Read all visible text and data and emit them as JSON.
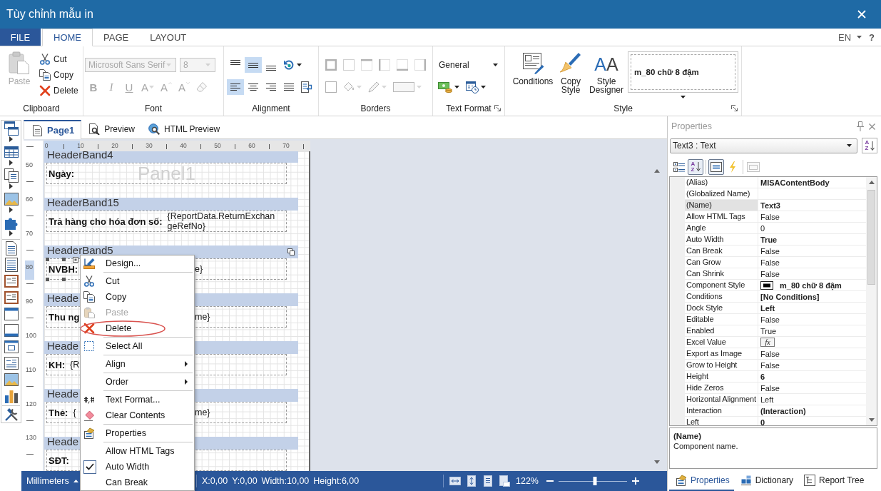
{
  "window": {
    "title": "Tùy chỉnh mẫu in"
  },
  "ribbon": {
    "tabs": [
      {
        "label": "FILE",
        "kind": "file",
        "selected": false
      },
      {
        "label": "HOME",
        "kind": "tab",
        "selected": true
      },
      {
        "label": "PAGE",
        "kind": "tab",
        "selected": false
      },
      {
        "label": "LAYOUT",
        "kind": "tab",
        "selected": false
      }
    ],
    "language": "EN",
    "help": "?",
    "groups": [
      {
        "label": "Clipboard",
        "launcher": false,
        "items": [
          {
            "kind": "large",
            "label": "Paste",
            "disabled": true
          },
          {
            "kind": "small",
            "label": "Cut",
            "disabled": false
          },
          {
            "kind": "small",
            "label": "Copy",
            "disabled": false
          },
          {
            "kind": "small",
            "label": "Delete",
            "disabled": false
          }
        ]
      },
      {
        "label": "Font",
        "launcher": false,
        "lines": [
          {
            "items": [
              {
                "kind": "combo",
                "value": "Microsoft Sans Serif",
                "disabled": true
              },
              {
                "kind": "combo",
                "value": "8",
                "disabled": true
              }
            ]
          },
          {
            "items": [
              {
                "kind": "glyph",
                "label": "B",
                "disabled": true
              },
              {
                "kind": "glyph",
                "label": "I",
                "disabled": true
              },
              {
                "kind": "glyph",
                "label": "U",
                "disabled": true
              },
              {
                "kind": "glyph",
                "label": "A",
                "dropdown": true,
                "disabled": true
              },
              {
                "kind": "glyph",
                "label": "A",
                "disabled": true
              },
              {
                "kind": "glyph",
                "label": "A",
                "disabled": true
              },
              {
                "kind": "icon",
                "disabled": true
              }
            ]
          }
        ]
      },
      {
        "label": "Alignment",
        "launcher": false,
        "lines": [
          {
            "items": [
              {
                "kind": "icon",
                "selected": false
              },
              {
                "kind": "icon",
                "selected": true
              },
              {
                "kind": "icon",
                "selected": false
              },
              {
                "kind": "icon",
                "dropdown": true,
                "selected": false
              }
            ]
          },
          {
            "items": [
              {
                "kind": "icon",
                "selected": true
              },
              {
                "kind": "icon",
                "selected": false
              },
              {
                "kind": "icon",
                "selected": false
              },
              {
                "kind": "icon",
                "selected": false
              },
              {
                "kind": "icon",
                "selected": false
              }
            ]
          }
        ]
      },
      {
        "label": "Borders",
        "launcher": false,
        "lines": [
          {
            "items": [
              {
                "kind": "icon",
                "disabled": true
              },
              {
                "kind": "icon",
                "disabled": true
              },
              {
                "kind": "icon",
                "disabled": true
              },
              {
                "kind": "icon",
                "disabled": true
              },
              {
                "kind": "icon",
                "disabled": true
              },
              {
                "kind": "icon",
                "disabled": true
              }
            ]
          },
          {
            "items": [
              {
                "kind": "icon",
                "disabled": true
              },
              {
                "kind": "icon",
                "dropdown": true,
                "disabled": true
              },
              {
                "kind": "icon",
                "dropdown": true,
                "disabled": true
              },
              {
                "kind": "icon",
                "dropdown": true,
                "disabled": true
              }
            ]
          }
        ]
      },
      {
        "label": "Text Format",
        "launcher": true,
        "lines": [
          {
            "items": [
              {
                "kind": "combo",
                "value": "General",
                "disabled": false
              }
            ]
          },
          {
            "items": [
              {
                "kind": "icon",
                "dropdown": true
              },
              {
                "kind": "icon",
                "dropdown": true
              }
            ]
          }
        ]
      },
      {
        "label": "Style",
        "launcher": true,
        "items": [
          {
            "kind": "large",
            "label": "Conditions"
          },
          {
            "kind": "large",
            "label": "Copy Style"
          },
          {
            "kind": "large",
            "label": "Style Designer",
            "glyph": "AA"
          },
          {
            "kind": "gallery",
            "value": "m_80 chữ 8 đậm"
          }
        ]
      }
    ]
  },
  "designer": {
    "tabs": [
      {
        "label": "Page1",
        "selected": true
      },
      {
        "label": "Preview",
        "selected": false
      },
      {
        "label": "HTML Preview",
        "selected": false
      }
    ],
    "rulers": {
      "horizontal": [
        "0",
        "10",
        "20",
        "30",
        "40",
        "50",
        "60",
        "70"
      ],
      "vertical": [
        "50",
        "60",
        "70",
        "80",
        "90",
        "100",
        "110",
        "120",
        "130"
      ]
    },
    "bands": [
      {
        "title": "HeaderBand4",
        "selected": false,
        "panel": "Panel1",
        "fields": [
          {
            "kind": "label",
            "text": "Ngày:",
            "selected": false
          }
        ]
      },
      {
        "title": "HeaderBand15",
        "selected": false,
        "fields": [
          {
            "kind": "label",
            "text": "Trả hàng cho hóa đơn số:",
            "selected": false
          },
          {
            "kind": "value",
            "text": "{ReportData.ReturnExchangeRefNo}",
            "selected": false
          }
        ]
      },
      {
        "title": "HeaderBand5",
        "selected": true,
        "fields": [
          {
            "kind": "label",
            "text": "NVBH:",
            "selected": true
          },
          {
            "kind": "tail",
            "text": "e}",
            "selected": false
          }
        ]
      },
      {
        "title": "Heade",
        "selected": false,
        "fields": [
          {
            "kind": "label",
            "text": "Thu ng",
            "selected": false
          },
          {
            "kind": "tail",
            "text": "me}",
            "selected": false
          }
        ]
      },
      {
        "title": "Heade",
        "selected": false,
        "fields": [
          {
            "kind": "label",
            "text": "KH:",
            "selected": false
          },
          {
            "kind": "value",
            "text": "{R",
            "selected": false
          }
        ]
      },
      {
        "title": "Heade",
        "selected": false,
        "fields": [
          {
            "kind": "label",
            "text": "Thẻ:",
            "selected": false
          },
          {
            "kind": "value",
            "text": "{",
            "selected": false
          },
          {
            "kind": "tail",
            "text": "me}",
            "selected": false
          }
        ]
      },
      {
        "title": "Heade",
        "selected": false,
        "fields": [
          {
            "kind": "label",
            "text": "SĐT:",
            "selected": false
          }
        ]
      }
    ]
  },
  "status_bar": {
    "units": "Millimeters",
    "position": [
      "X:0,00",
      "Y:0,00",
      "Width:10,00",
      "Height:6,00"
    ],
    "zoom": "122%",
    "zoom_slider": {
      "level": 0.53
    }
  },
  "context_menu": {
    "items": [
      {
        "kind": "command",
        "label": "Design...",
        "disabled": false
      },
      {
        "kind": "separator"
      },
      {
        "kind": "command",
        "label": "Cut",
        "disabled": false
      },
      {
        "kind": "command",
        "label": "Copy",
        "disabled": false
      },
      {
        "kind": "command",
        "label": "Paste",
        "disabled": true
      },
      {
        "kind": "command",
        "label": "Delete",
        "disabled": false,
        "circled": true
      },
      {
        "kind": "separator"
      },
      {
        "kind": "command",
        "label": "Select All",
        "disabled": false
      },
      {
        "kind": "separator"
      },
      {
        "kind": "submenu",
        "label": "Align",
        "disabled": false
      },
      {
        "kind": "separator"
      },
      {
        "kind": "submenu",
        "label": "Order",
        "disabled": false
      },
      {
        "kind": "separator"
      },
      {
        "kind": "command",
        "label": "Text Format...",
        "disabled": false
      },
      {
        "kind": "command",
        "label": "Clear Contents",
        "disabled": false
      },
      {
        "kind": "separator"
      },
      {
        "kind": "command",
        "label": "Properties",
        "disabled": false
      },
      {
        "kind": "separator"
      },
      {
        "kind": "check",
        "label": "Allow HTML Tags",
        "checked": false
      },
      {
        "kind": "check",
        "label": "Auto Width",
        "checked": true
      },
      {
        "kind": "check",
        "label": "Can Break",
        "checked": false
      }
    ]
  },
  "properties": {
    "title": "Properties",
    "object": "Text3 : Text",
    "sort_button": "AZ",
    "toolbar": [
      {
        "kind": "icon",
        "selected": false,
        "disabled": false
      },
      {
        "kind": "glyph",
        "label": "AZ",
        "selected": true,
        "disabled": false
      },
      {
        "kind": "icon",
        "selected": true,
        "disabled": false
      },
      {
        "kind": "icon",
        "selected": false,
        "disabled": false
      },
      {
        "kind": "icon",
        "selected": false,
        "disabled": true
      }
    ],
    "rows": [
      {
        "name": "(Alias)",
        "kind": "text",
        "value": "MISAContentBody",
        "modified": true,
        "selected": false
      },
      {
        "name": "(Globalized Name)",
        "kind": "text",
        "selected": false
      },
      {
        "name": "(Name)",
        "kind": "text",
        "value": "Text3",
        "modified": true,
        "selected": true
      },
      {
        "name": "Allow HTML Tags",
        "kind": "text",
        "value": "False",
        "modified": false,
        "selected": false
      },
      {
        "name": "Angle",
        "kind": "text",
        "value": "0",
        "modified": false,
        "selected": false
      },
      {
        "name": "Auto Width",
        "kind": "text",
        "value": "True",
        "modified": true,
        "selected": false
      },
      {
        "name": "Can Break",
        "kind": "text",
        "value": "False",
        "modified": false,
        "selected": false
      },
      {
        "name": "Can Grow",
        "kind": "text",
        "value": "False",
        "modified": false,
        "selected": false
      },
      {
        "name": "Can Shrink",
        "kind": "text",
        "value": "False",
        "modified": false,
        "selected": false
      },
      {
        "name": "Component Style",
        "kind": "style",
        "value": "m_80 chữ 8 đậm",
        "modified": true,
        "selected": false
      },
      {
        "name": "Conditions",
        "kind": "text",
        "value": "[No Conditions]",
        "modified": true,
        "selected": false
      },
      {
        "name": "Dock Style",
        "kind": "text",
        "value": "Left",
        "modified": true,
        "selected": false
      },
      {
        "name": "Editable",
        "kind": "text",
        "value": "False",
        "modified": false,
        "selected": false
      },
      {
        "name": "Enabled",
        "kind": "text",
        "value": "True",
        "modified": false,
        "selected": false
      },
      {
        "name": "Excel Value",
        "kind": "button",
        "value": "fx",
        "selected": false
      },
      {
        "name": "Export as Image",
        "kind": "text",
        "value": "False",
        "modified": false,
        "selected": false
      },
      {
        "name": "Grow to Height",
        "kind": "text",
        "value": "False",
        "modified": false,
        "selected": false
      },
      {
        "name": "Height",
        "kind": "text",
        "value": "6",
        "modified": true,
        "selected": false
      },
      {
        "name": "Hide Zeros",
        "kind": "text",
        "value": "False",
        "modified": false,
        "selected": false
      },
      {
        "name": "Horizontal Alignment",
        "kind": "text",
        "value": "Left",
        "modified": false,
        "selected": false
      },
      {
        "name": "Interaction",
        "kind": "text",
        "value": "(Interaction)",
        "modified": true,
        "selected": false
      },
      {
        "name": "Left",
        "kind": "text",
        "value": "0",
        "modified": true,
        "selected": false
      }
    ],
    "description": {
      "title": "(Name)",
      "text": "Component name."
    },
    "tabs": [
      {
        "label": "Properties",
        "selected": true
      },
      {
        "label": "Dictionary",
        "selected": false
      },
      {
        "label": "Report Tree",
        "selected": false
      }
    ]
  }
}
